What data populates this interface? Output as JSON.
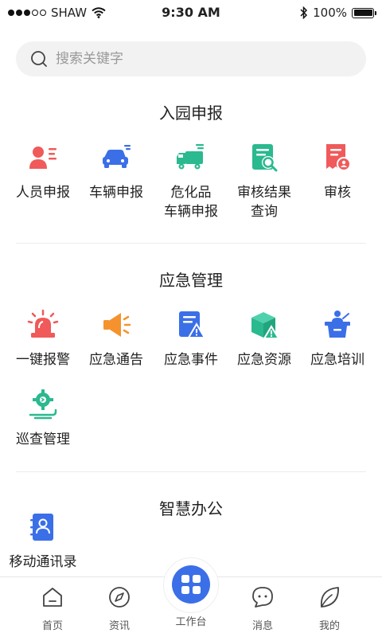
{
  "status_bar": {
    "carrier": "SHAW",
    "time": "9:30 AM",
    "battery": "100%"
  },
  "search": {
    "placeholder": "搜索关键字"
  },
  "sections": [
    {
      "title": "入园申报",
      "items": [
        {
          "label": "人员申报",
          "icon": "person-list-icon",
          "color": "#f05a5a"
        },
        {
          "label": "车辆申报",
          "icon": "car-icon",
          "color": "#3a6fe8"
        },
        {
          "label": "危化品\n车辆申报",
          "icon": "truck-icon",
          "color": "#2bb98f"
        },
        {
          "label": "审核结果\n查询",
          "icon": "document-search-icon",
          "color": "#2bb98f"
        },
        {
          "label": "审核",
          "icon": "document-user-icon",
          "color": "#f05a5a"
        }
      ]
    },
    {
      "title": "应急管理",
      "items": [
        {
          "label": "一键报警",
          "icon": "alarm-light-icon",
          "color": "#f05a5a"
        },
        {
          "label": "应急通告",
          "icon": "megaphone-icon",
          "color": "#f5922d"
        },
        {
          "label": "应急事件",
          "icon": "document-warning-icon",
          "color": "#3a6fe8"
        },
        {
          "label": "应急资源",
          "icon": "box-warning-icon",
          "color": "#2bb98f"
        },
        {
          "label": "应急培训",
          "icon": "podium-icon",
          "color": "#3a6fe8"
        },
        {
          "label": "巡查管理",
          "icon": "patrol-gear-icon",
          "color": "#2bb98f"
        }
      ]
    },
    {
      "title": "智慧办公",
      "items": [
        {
          "label": "移动通讯录",
          "icon": "contacts-book-icon",
          "color": "#3a6fe8"
        }
      ]
    }
  ],
  "tabbar": {
    "items": [
      {
        "label": "首页",
        "icon": "home-icon"
      },
      {
        "label": "资讯",
        "icon": "compass-icon"
      },
      {
        "label": "工作台",
        "icon": "grid-icon",
        "active_color": "#3a6fe8"
      },
      {
        "label": "消息",
        "icon": "message-icon"
      },
      {
        "label": "我的",
        "icon": "leaf-icon"
      }
    ]
  }
}
